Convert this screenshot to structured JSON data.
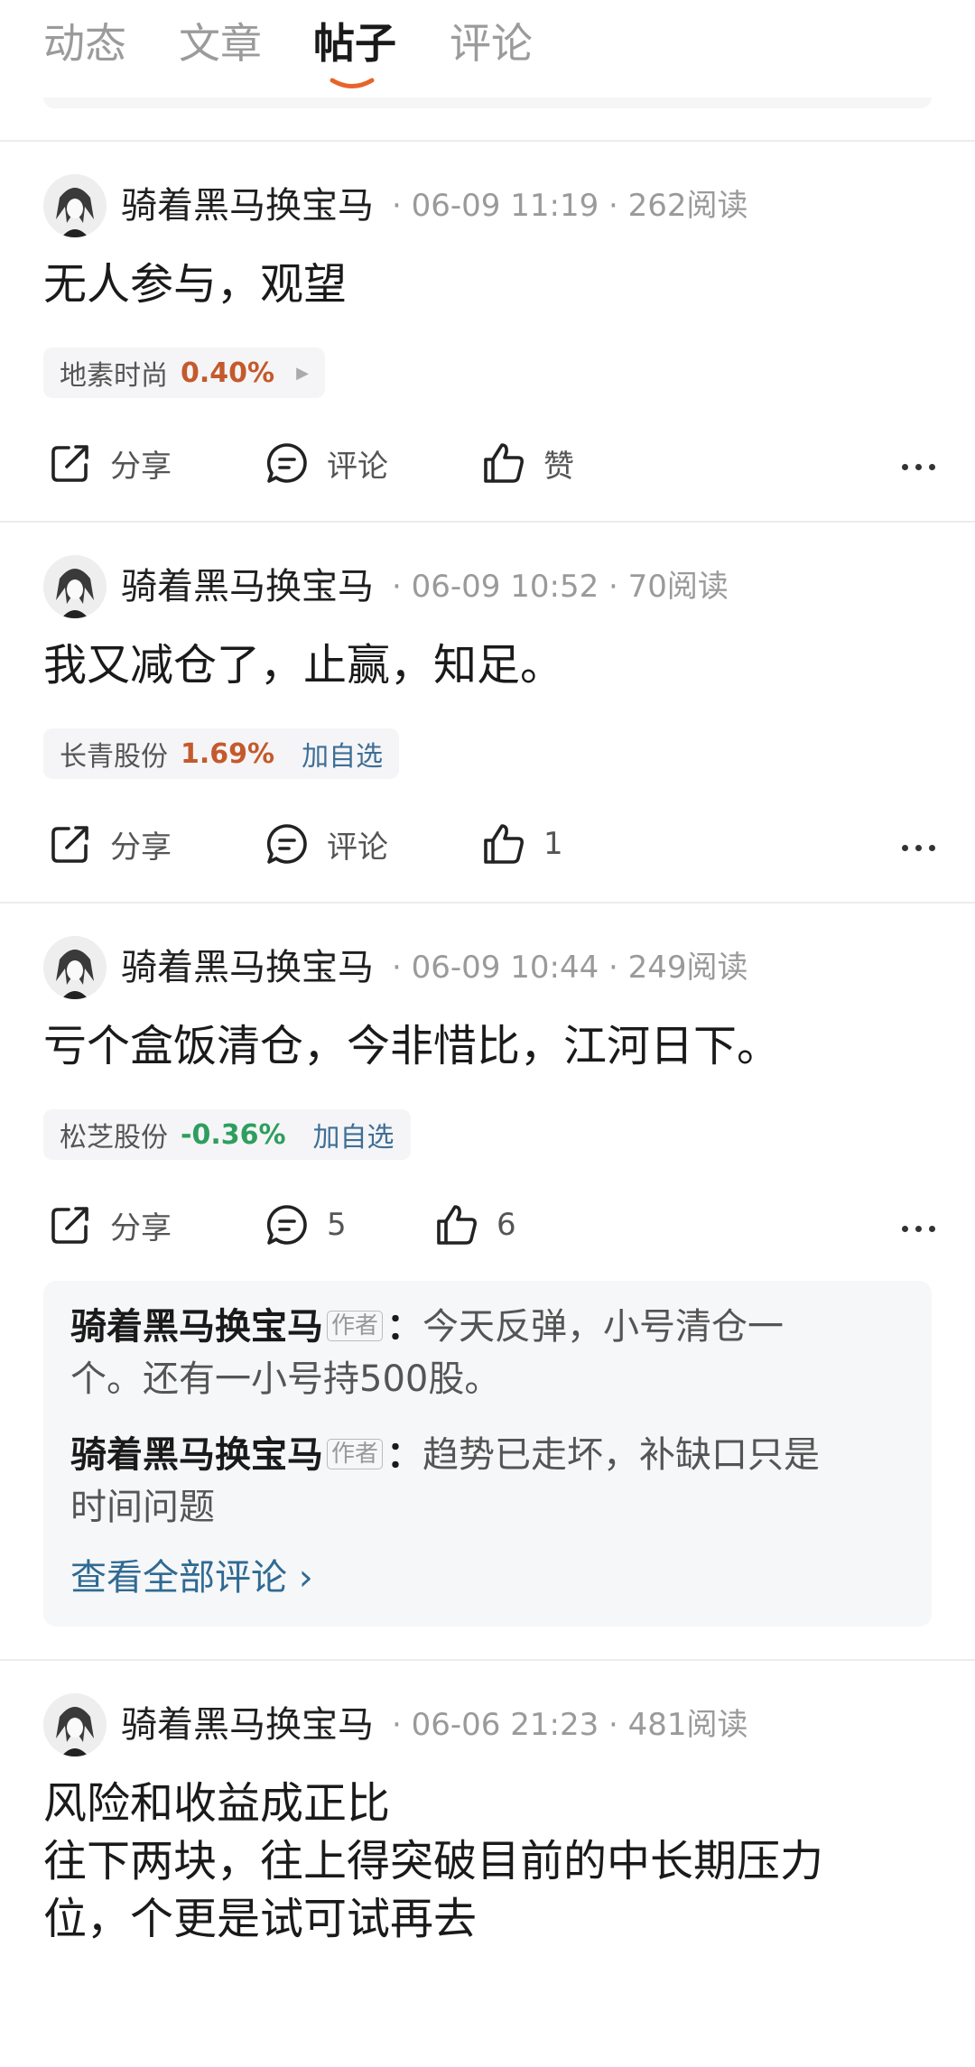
{
  "tabs": [
    "动态",
    "文章",
    "帖子",
    "评论"
  ],
  "active_tab": "帖子",
  "posts": [
    {
      "author": "骑着黑马换宝马",
      "meta": "· 06-09 11:19 · 262阅读",
      "content": "无人参与，观望",
      "stock": {
        "name": "地素时尚",
        "pct": "0.40%",
        "arrow": "▶"
      },
      "share": "分享",
      "comment": "评论",
      "like": "赞"
    },
    {
      "author": "骑着黑马换宝马",
      "meta": "· 06-09 10:52 · 70阅读",
      "content": "我又减仓了，止赢，知足。",
      "stock": {
        "name": "长青股份",
        "pct": "1.69%",
        "add": "加自选"
      },
      "share": "分享",
      "comment": "评论",
      "like": "1"
    },
    {
      "author": "骑着黑马换宝马",
      "meta": "· 06-09 10:44 · 249阅读",
      "content": "亏个盒饭清仓，今非惜比，江河日下。",
      "stock": {
        "name": "松芝股份",
        "pct": "-0.36%",
        "add": "加自选"
      },
      "share": "分享",
      "comment": "5",
      "like": "6",
      "comments": [
        {
          "author": "骑着黑马换宝马",
          "tag": "作者",
          "colon": "：",
          "text1": "今天反弹，小号清仓一",
          "text2": "个。还有一小号持500股。"
        },
        {
          "author": "骑着黑马换宝马",
          "tag": "作者",
          "colon": "：",
          "text1": "趋势已走坏，补缺口只是",
          "text2": "时间问题"
        }
      ],
      "view_all": "查看全部评论 ›"
    },
    {
      "author": "骑着黑马换宝马",
      "meta": "· 06-06 21:23 · 481阅读",
      "content_lines": [
        "风险和收益成正比",
        "往下两块，往上得突破目前的中长期压力",
        "位，个更是试可试再去"
      ]
    }
  ],
  "colors": {
    "up": "#c45a2c",
    "down": "#2e9e5e",
    "link": "#2f6a93",
    "accent": "#e8632b"
  }
}
